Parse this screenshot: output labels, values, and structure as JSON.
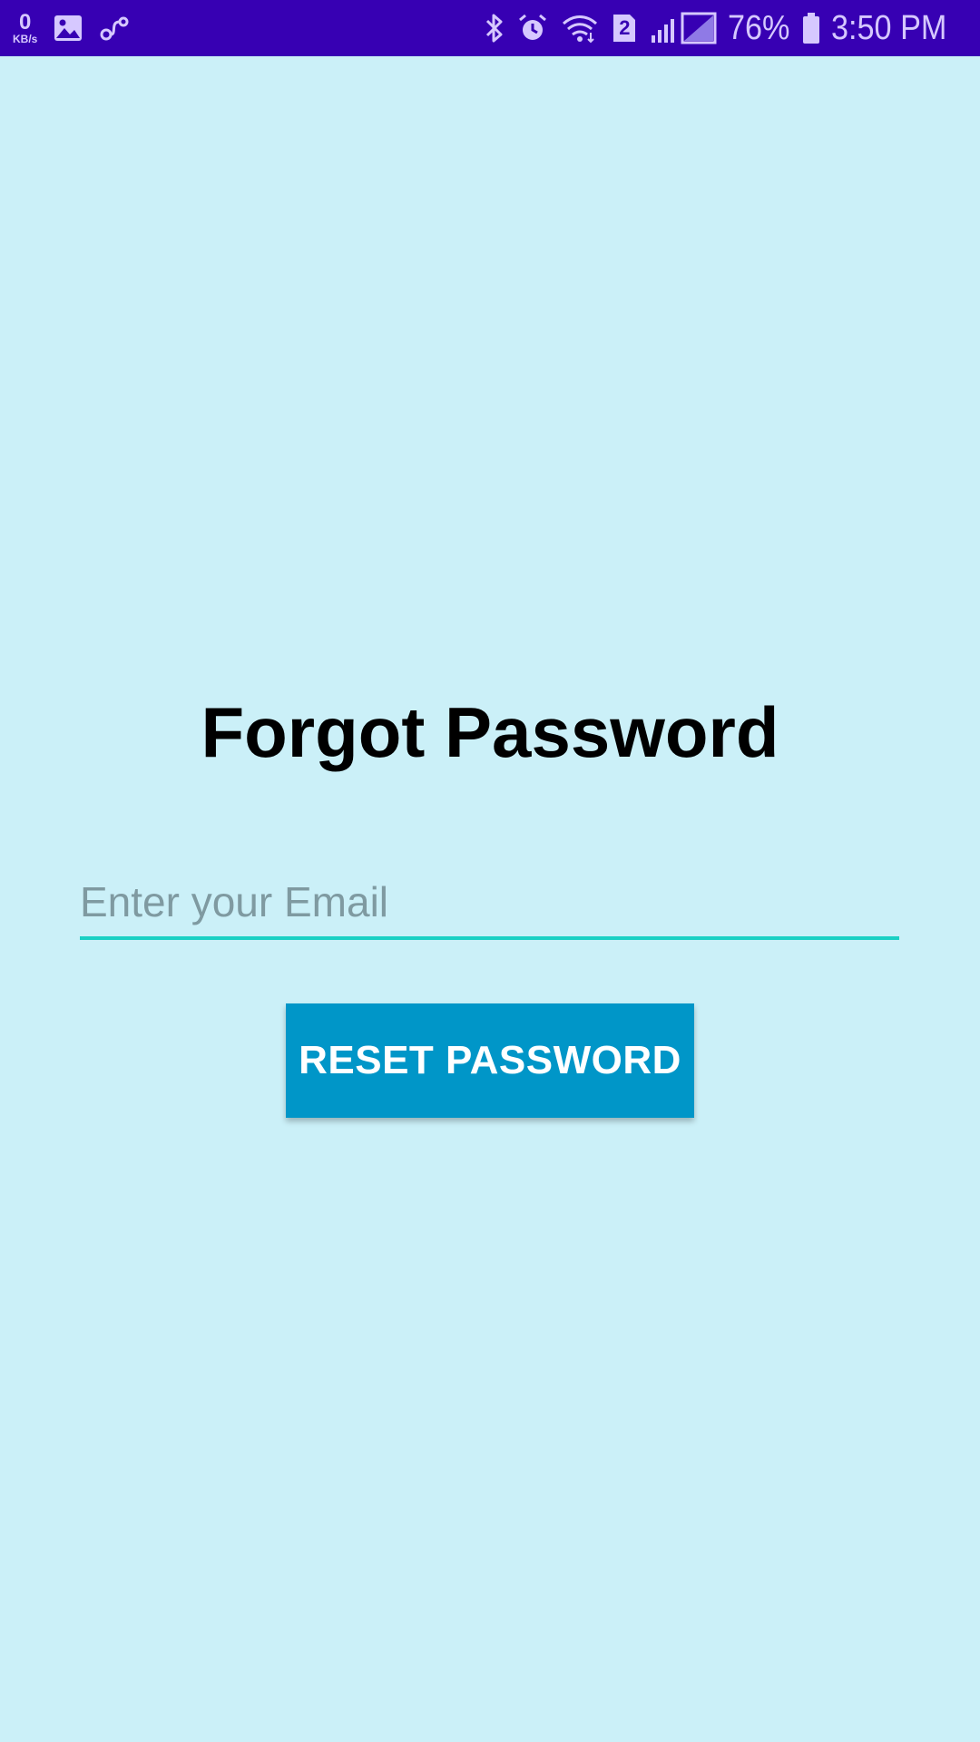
{
  "status_bar": {
    "net_speed_value": "0",
    "net_speed_unit": "KB/s",
    "left_icons": [
      "image-icon",
      "link-icon"
    ],
    "right_icons": [
      "bluetooth-icon",
      "alarm-icon",
      "wifi-icon",
      "sim2-icon",
      "signal-icon"
    ],
    "sim_label": "2",
    "battery_percent": "76%",
    "time": "3:50 PM",
    "background_color": "#3700b3"
  },
  "page": {
    "background_color": "#cbf0f8",
    "title": "Forgot Password"
  },
  "email_field": {
    "placeholder": "Enter your Email",
    "value": "",
    "underline_color": "#1bd0c4"
  },
  "reset_button": {
    "label": "RESET PASSWORD",
    "color": "#0096c8"
  }
}
